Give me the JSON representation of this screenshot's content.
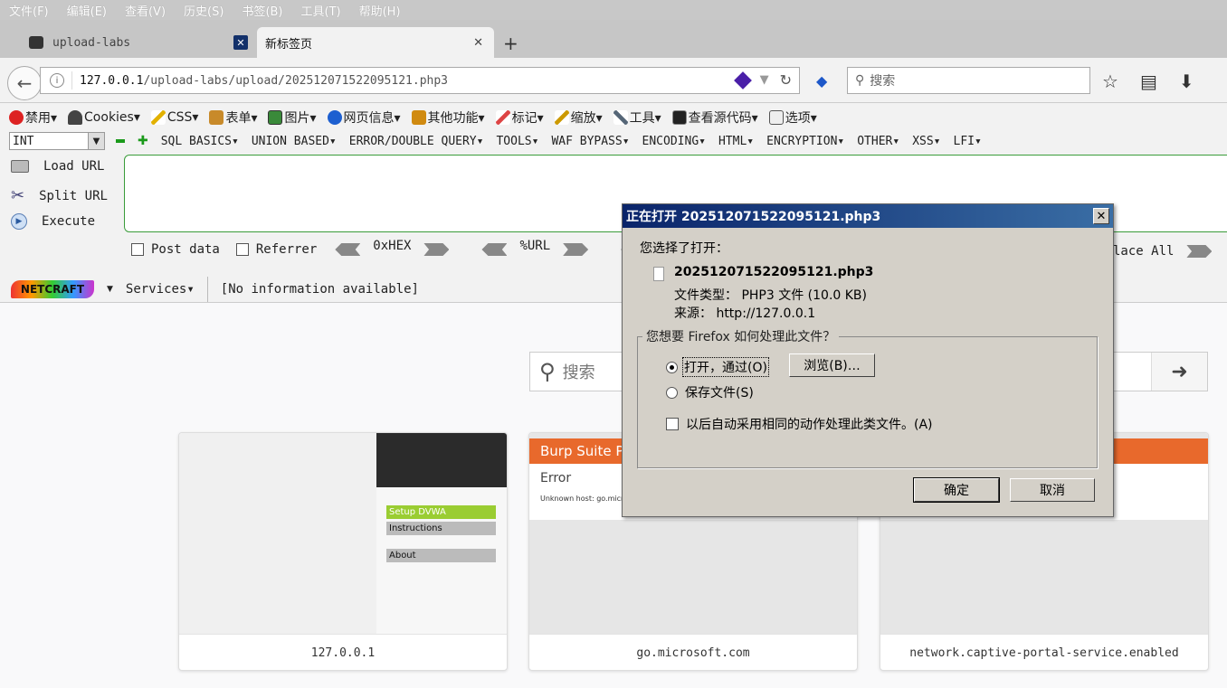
{
  "menubar": [
    "文件(F)",
    "编辑(E)",
    "查看(V)",
    "历史(S)",
    "书签(B)",
    "工具(T)",
    "帮助(H)"
  ],
  "tabs": [
    {
      "label": "upload-labs"
    },
    {
      "label": "新标签页"
    }
  ],
  "nav": {
    "url_host": "127.0.0.1",
    "url_path": "/upload-labs/upload/202512071522095121.php3",
    "search_placeholder": "搜索"
  },
  "hackbar": {
    "menu": [
      "禁用▾",
      "Cookies▾",
      "CSS▾",
      "表单▾",
      "图片▾",
      "网页信息▾",
      "其他功能▾",
      "标记▾",
      "缩放▾",
      "工具▾",
      "查看源代码▾",
      "选项▾"
    ],
    "type_select": "INT",
    "submenu": [
      "SQL BASICS▾",
      "UNION BASED▾",
      "ERROR/DOUBLE QUERY▾",
      "TOOLS▾",
      "WAF BYPASS▾",
      "ENCODING▾",
      "HTML▾",
      "ENCRYPTION▾",
      "OTHER▾",
      "XSS▾",
      "LFI▾"
    ],
    "load_url": "Load URL",
    "split_url": "Split URL",
    "execute": "Execute",
    "post_data": "Post data",
    "referrer": "Referrer",
    "hex": "0xHEX",
    "url_enc": "%URL",
    "replace_all": "lace All",
    "netcraft_logo": "NETCRAFT",
    "services": "Services▾",
    "netcraft_info": "[No information available]"
  },
  "newtab": {
    "search_placeholder": "搜索",
    "tiles": [
      {
        "label": "127.0.0.1",
        "menu": [
          "Setup DVWA",
          "Instructions",
          "About"
        ]
      },
      {
        "label": "go.microsoft.com",
        "header": "Burp Suite Pr",
        "title": "Error",
        "text": "Unknown host: go.micro"
      },
      {
        "label": "network.captive-portal-service.enabled"
      }
    ]
  },
  "dialog": {
    "title": "正在打开 202512071522095121.php3",
    "intro": "您选择了打开：",
    "filename": "202512071522095121.php3",
    "filetype": "文件类型： PHP3 文件 (10.0 KB)",
    "source": "来源： http://127.0.0.1",
    "question": "您想要 Firefox 如何处理此文件？",
    "open_with": "打开，通过(O)",
    "browse": "浏览(B)…",
    "save_file": "保存文件(S)",
    "auto": "以后自动采用相同的动作处理此类文件。(A)",
    "ok": "确定",
    "cancel": "取消"
  }
}
